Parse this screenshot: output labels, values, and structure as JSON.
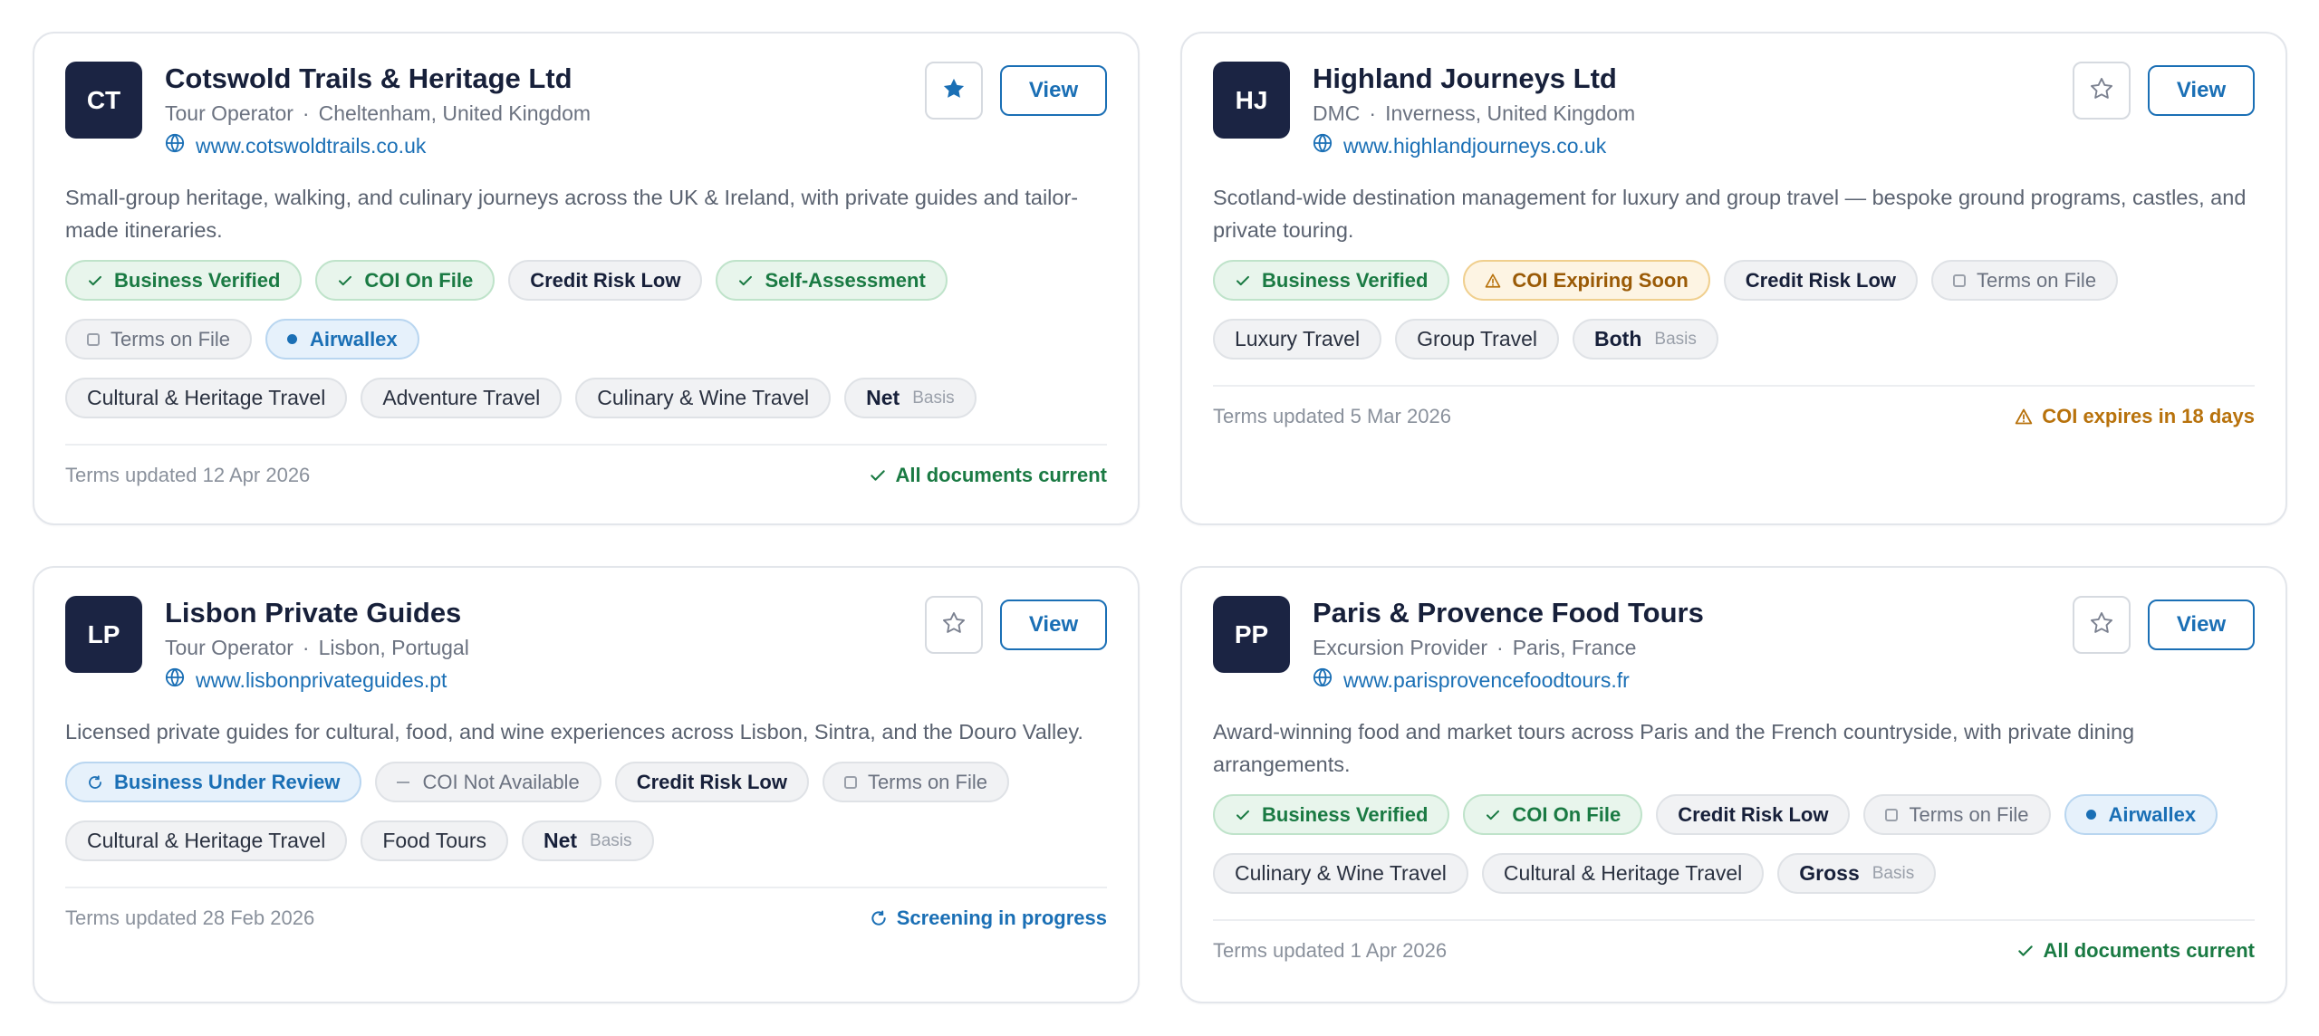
{
  "colors": {
    "accent": "#1a6fb5",
    "avatar_bg": "#1b2443",
    "verified_green": "#1a7a43",
    "warning_amber": "#b8720c"
  },
  "cards": [
    {
      "initials": "CT",
      "name": "Cotswold Trails & Heritage Ltd",
      "type": "Tour Operator",
      "location": "Cheltenham, United Kingdom",
      "website": "www.cotswoldtrails.co.uk",
      "starred": true,
      "view_label": "View",
      "description": "Small-group heritage, walking, and culinary journeys across the UK & Ireland, with private guides and tailor-made itineraries.",
      "badges": [
        {
          "label": "Business Verified",
          "style": "green",
          "icon": "check-icon"
        },
        {
          "label": "COI On File",
          "style": "green",
          "icon": "check-icon"
        },
        {
          "label": "Credit Risk Low",
          "style": "dark",
          "icon": ""
        },
        {
          "label": "Self-Assessment",
          "style": "green",
          "icon": "check-icon"
        },
        {
          "label": "Terms on File",
          "style": "gray",
          "icon": "square-icon"
        },
        {
          "label": "Airwallex",
          "style": "blue",
          "icon": "dot-icon"
        }
      ],
      "tags": [
        "Cultural & Heritage Travel",
        "Adventure Travel",
        "Culinary & Wine Travel"
      ],
      "basis_value": "Net",
      "basis_label": "Basis",
      "terms_updated": "Terms updated 12 Apr 2026",
      "status": "All documents current",
      "status_style": "green"
    },
    {
      "initials": "HJ",
      "name": "Highland Journeys Ltd",
      "type": "DMC",
      "location": "Inverness, United Kingdom",
      "website": "www.highlandjourneys.co.uk",
      "starred": false,
      "view_label": "View",
      "description": "Scotland-wide destination management for luxury and group travel — bespoke ground programs, castles, and private touring.",
      "badges": [
        {
          "label": "Business Verified",
          "style": "green",
          "icon": "check-icon"
        },
        {
          "label": "COI Expiring Soon",
          "style": "amber",
          "icon": "warning-icon"
        },
        {
          "label": "Credit Risk Low",
          "style": "dark",
          "icon": ""
        },
        {
          "label": "Terms on File",
          "style": "gray",
          "icon": "square-icon"
        }
      ],
      "tags": [
        "Luxury Travel",
        "Group Travel"
      ],
      "basis_value": "Both",
      "basis_label": "Basis",
      "terms_updated": "Terms updated 5 Mar 2026",
      "status": "COI expires in 18 days",
      "status_style": "amber"
    },
    {
      "initials": "LP",
      "name": "Lisbon Private Guides",
      "type": "Tour Operator",
      "location": "Lisbon, Portugal",
      "website": "www.lisbonprivateguides.pt",
      "starred": false,
      "view_label": "View",
      "description": "Licensed private guides for cultural, food, and wine experiences across Lisbon, Sintra, and the Douro Valley.",
      "badges": [
        {
          "label": "Business Under Review",
          "style": "blue",
          "icon": "refresh-icon"
        },
        {
          "label": "COI Not Available",
          "style": "gray",
          "icon": "dash-icon"
        },
        {
          "label": "Credit Risk Low",
          "style": "dark",
          "icon": ""
        },
        {
          "label": "Terms on File",
          "style": "gray",
          "icon": "square-icon"
        }
      ],
      "tags": [
        "Cultural & Heritage Travel",
        "Food Tours"
      ],
      "basis_value": "Net",
      "basis_label": "Basis",
      "terms_updated": "Terms updated 28 Feb 2026",
      "status": "Screening in progress",
      "status_style": "blue"
    },
    {
      "initials": "PP",
      "name": "Paris & Provence Food Tours",
      "type": "Excursion Provider",
      "location": "Paris, France",
      "website": "www.parisprovencefoodtours.fr",
      "starred": false,
      "view_label": "View",
      "description": "Award-winning food and market tours across Paris and the French countryside, with private dining arrangements.",
      "badges": [
        {
          "label": "Business Verified",
          "style": "green",
          "icon": "check-icon"
        },
        {
          "label": "COI On File",
          "style": "green",
          "icon": "check-icon"
        },
        {
          "label": "Credit Risk Low",
          "style": "dark",
          "icon": ""
        },
        {
          "label": "Terms on File",
          "style": "gray",
          "icon": "square-icon"
        },
        {
          "label": "Airwallex",
          "style": "blue",
          "icon": "dot-icon"
        }
      ],
      "tags": [
        "Culinary & Wine Travel",
        "Cultural & Heritage Travel"
      ],
      "basis_value": "Gross",
      "basis_label": "Basis",
      "terms_updated": "Terms updated 1 Apr 2026",
      "status": "All documents current",
      "status_style": "green"
    }
  ]
}
